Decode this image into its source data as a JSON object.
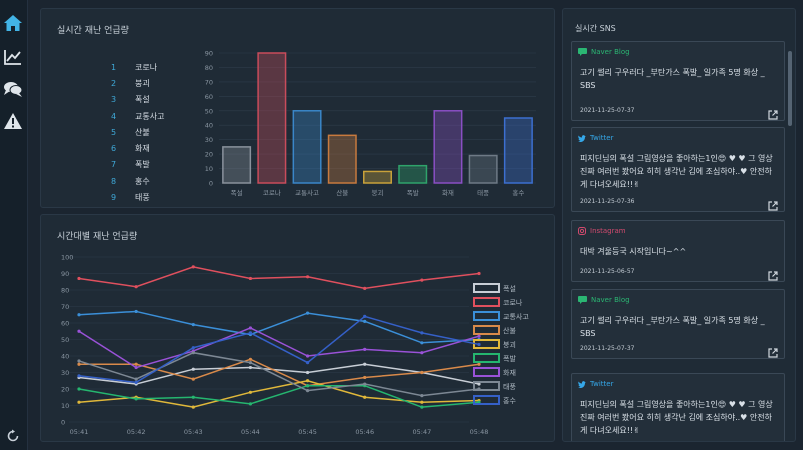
{
  "sidebar": {
    "icons": [
      "home-icon",
      "trend-chart-icon",
      "chat-icon",
      "warning-icon",
      "refresh-icon"
    ],
    "accent": "#42b4e6"
  },
  "ranking_panel": {
    "title": "실시간 재난 언급량",
    "items": [
      {
        "rank": "1",
        "name": "코로나"
      },
      {
        "rank": "2",
        "name": "붕괴"
      },
      {
        "rank": "3",
        "name": "폭설"
      },
      {
        "rank": "4",
        "name": "교통사고"
      },
      {
        "rank": "5",
        "name": "산불"
      },
      {
        "rank": "6",
        "name": "화재"
      },
      {
        "rank": "7",
        "name": "폭발"
      },
      {
        "rank": "8",
        "name": "홍수"
      },
      {
        "rank": "9",
        "name": "태풍"
      }
    ]
  },
  "line_panel": {
    "title": "시간대별 재난 언급량"
  },
  "sns_panel": {
    "title": "실시간 SNS",
    "cards": [
      {
        "source": "Naver Blog",
        "source_color": "#2bb673",
        "icon": "naver-blog-icon",
        "text": "고기 썰리 구우러다 _부탄가스 폭발_ 일가족 5명 화상 _ SBS",
        "date": "2021-11-25-07-37"
      },
      {
        "source": "Twitter",
        "source_color": "#35a7e8",
        "icon": "twitter-icon",
        "text": "피지딘님의 폭설 그림영상을 좋아하는1인😍 ♥ ♥ 그 영상 진짜 여러번 봤어요 히히 생각난 김에 조심하야..♥ 안전하게 다녀오세요!!✌",
        "date": "2021-11-25-07-36"
      },
      {
        "source": "Instagram",
        "source_color": "#d04a6e",
        "icon": "instagram-icon",
        "text": "대박 겨울등국 시작입니다~^^",
        "date": "2021-11-25-06-57"
      },
      {
        "source": "Naver Blog",
        "source_color": "#2bb673",
        "icon": "naver-blog-icon",
        "text": "고기 썰리 구우러다 _부탄가스 폭발_ 일가족 5명 화상 _ SBS",
        "date": "2021-11-25-07-37"
      },
      {
        "source": "Twitter",
        "source_color": "#35a7e8",
        "icon": "twitter-icon",
        "text": "피지딘님의 폭설 그림영상을 좋아하는1인😍 ♥ ♥ 그 영상 진짜 여러번 봤어요 히히 생각난 김에 조심하야..♥ 안전하게 다녀오세요!!✌",
        "date": ""
      }
    ]
  },
  "chart_data": [
    {
      "type": "bar",
      "categories": [
        "폭설",
        "코로나",
        "교통사고",
        "산불",
        "붕괴",
        "폭발",
        "화재",
        "태풍",
        "홍수"
      ],
      "values": [
        25,
        90,
        50,
        33,
        8,
        12,
        50,
        19,
        45
      ],
      "colors": [
        "#8a929c",
        "#c94c5b",
        "#3a86c8",
        "#c87a3e",
        "#c9a23a",
        "#2fa36b",
        "#8a4fc4",
        "#6e7a86",
        "#3c6fd0"
      ],
      "ylim": [
        0,
        90
      ],
      "yticks": [
        0,
        10,
        20,
        30,
        40,
        50,
        60,
        70,
        80,
        90
      ],
      "grid": true
    },
    {
      "type": "line",
      "x": [
        "05:41",
        "05:42",
        "05:43",
        "05:44",
        "05:45",
        "05:46",
        "05:47",
        "05:48"
      ],
      "ylim": [
        0,
        100
      ],
      "yticks": [
        0,
        10,
        20,
        30,
        40,
        50,
        60,
        70,
        80,
        90,
        100
      ],
      "legend": "right",
      "series": [
        {
          "name": "폭설",
          "color": "#c8ced6",
          "values": [
            27,
            23,
            32,
            33,
            30,
            35,
            30,
            23
          ]
        },
        {
          "name": "코로나",
          "color": "#e0505e",
          "values": [
            87,
            82,
            94,
            87,
            88,
            81,
            86,
            90
          ]
        },
        {
          "name": "교통사고",
          "color": "#3b8fd8",
          "values": [
            65,
            67,
            59,
            53,
            66,
            61,
            48,
            50
          ]
        },
        {
          "name": "산불",
          "color": "#d98a4a",
          "values": [
            35,
            35,
            26,
            38,
            22,
            27,
            30,
            35
          ]
        },
        {
          "name": "붕괴",
          "color": "#e0b83a",
          "values": [
            12,
            15,
            9,
            18,
            25,
            15,
            12,
            13
          ]
        },
        {
          "name": "폭발",
          "color": "#25b66f",
          "values": [
            20,
            14,
            15,
            11,
            22,
            22,
            9,
            12
          ]
        },
        {
          "name": "화재",
          "color": "#9a52d8",
          "values": [
            55,
            33,
            43,
            57,
            40,
            44,
            42,
            52
          ]
        },
        {
          "name": "태풍",
          "color": "#7d8894",
          "values": [
            37,
            26,
            42,
            36,
            19,
            23,
            16,
            20
          ]
        },
        {
          "name": "홍수",
          "color": "#3560c8",
          "values": [
            28,
            24,
            45,
            54,
            36,
            64,
            54,
            47
          ]
        }
      ]
    }
  ]
}
